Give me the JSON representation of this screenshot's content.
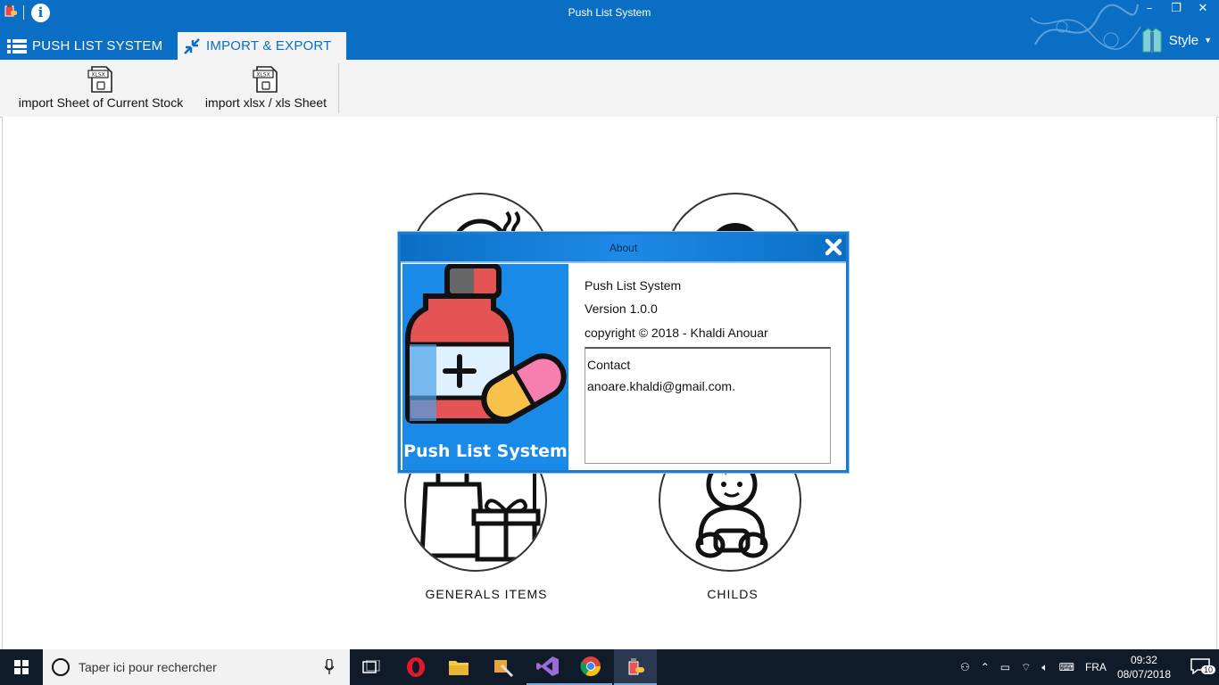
{
  "window": {
    "title": "Push List System",
    "controls": {
      "minimize": "–",
      "restore": "❐",
      "close": "✕"
    }
  },
  "tabs": [
    {
      "label": "PUSH LIST SYSTEM",
      "icon": "list-icon"
    },
    {
      "label": "IMPORT & EXPORT",
      "icon": "compress-arrows-icon",
      "active": true
    }
  ],
  "style_menu": {
    "label": "Style",
    "icon": "shirt-icon"
  },
  "ribbon": {
    "buttons": [
      {
        "label": "import Sheet of Current Stock",
        "icon": "xlsx-file-icon",
        "badge": "XLSX"
      },
      {
        "label": "import xlsx / xls Sheet",
        "icon": "xlsx-file-icon",
        "badge": "XLSX"
      }
    ]
  },
  "categories": [
    {
      "label": "GENERALS ITEMS",
      "icon": "shopping-gift-icon"
    },
    {
      "label": "CHILDS",
      "icon": "baby-icon"
    }
  ],
  "about": {
    "title": "About",
    "logo_text": "Push List System",
    "app_name": "Push List System",
    "version": "Version 1.0.0",
    "copyright": "copyright © 2018 - Khaldi Anouar",
    "contact_label": "Contact",
    "contact_email": "anoare.khaldi@gmail.com."
  },
  "taskbar": {
    "search_placeholder": "Taper ici pour rechercher",
    "language": "FRA",
    "time": "09:32",
    "date": "08/07/2018",
    "notification_count": "10"
  },
  "colors": {
    "accent": "#0a6fc4",
    "dialog_border": "#1a7ad4",
    "taskbar": "#101b2a"
  }
}
